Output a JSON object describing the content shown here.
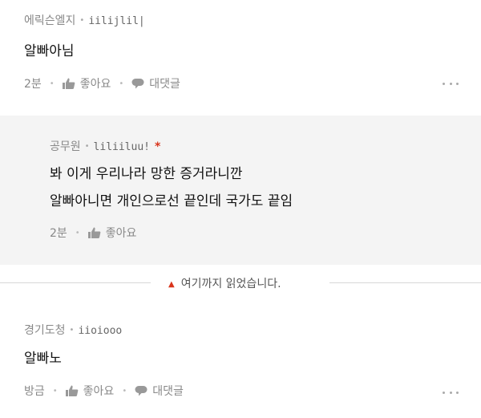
{
  "comments": [
    {
      "nickname": "에릭슨엘지",
      "user_id": "iilijlil|",
      "text": "알빠아님",
      "time": "2분",
      "like_label": "좋아요",
      "reply_label": "대댓글"
    },
    {
      "nickname": "공무원",
      "user_id": "liliiluu!",
      "badge": "*",
      "lines": [
        "봐 이게 우리나라 망한 증거라니깐",
        "알빠아니면 개인으로선 끝인데 국가도 끝임"
      ],
      "time": "2분",
      "like_label": "좋아요"
    },
    {
      "nickname": "경기도청",
      "user_id": "iioiooo",
      "text": "알빠노",
      "time": "방금",
      "like_label": "좋아요",
      "reply_label": "대댓글"
    }
  ],
  "read_marker": {
    "label": "여기까지 읽었습니다.",
    "icon": "triangle-up-icon",
    "color": "#d9341b"
  },
  "colors": {
    "reply_bg": "#f4f4f4",
    "meta": "#888888",
    "accent": "#d9341b"
  }
}
